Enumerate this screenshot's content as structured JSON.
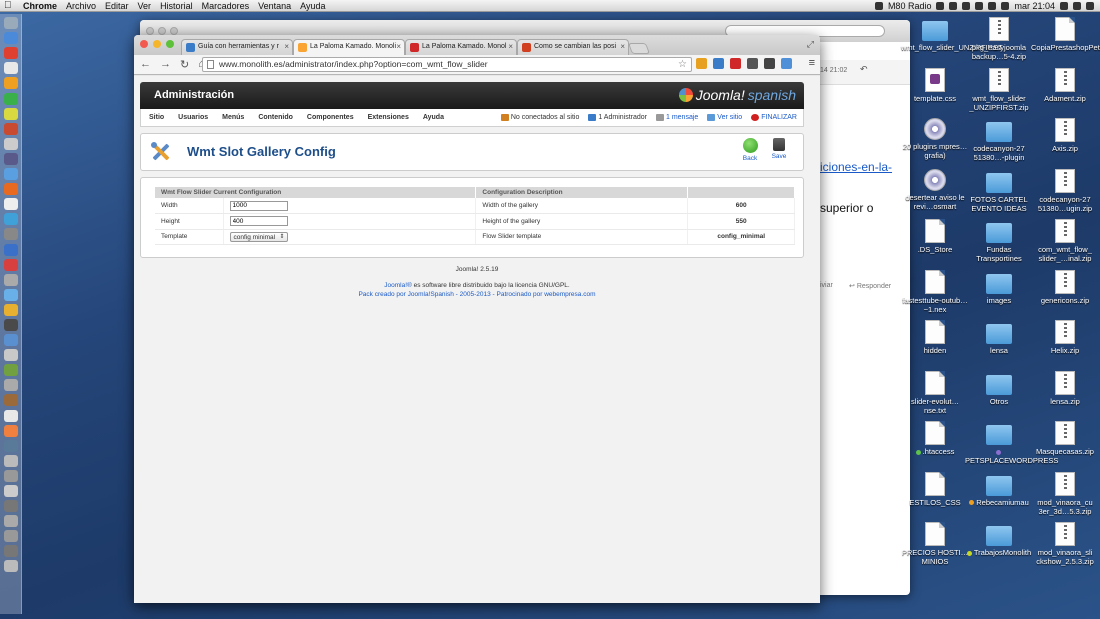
{
  "menubar": {
    "app": "Chrome",
    "menus": [
      "Archivo",
      "Editar",
      "Ver",
      "Historial",
      "Marcadores",
      "Ventana",
      "Ayuda"
    ],
    "radio": "M80 Radio",
    "clock": "mar 21:04"
  },
  "back_window": {
    "link_text": "iciones-en-la-",
    "text1": "superior o",
    "time": "14 21:02",
    "action_left": "iviar",
    "action_reply": "Responder"
  },
  "desktop_icons": [
    {
      "label": "wmt_flow_slider_UNZIPFIRST",
      "kind": "folder"
    },
    {
      "label": "pkg_easyjoomla backup…5-4.zip",
      "kind": "zip"
    },
    {
      "label": "CopiaPrestashopPetsPlace.sql.gz",
      "kind": "file"
    },
    {
      "label": "template.css",
      "kind": "css"
    },
    {
      "label": "wmt_flow_slider _UNZIPFIRST.zip",
      "kind": "zip"
    },
    {
      "label": "Adament.zip",
      "kind": "zip"
    },
    {
      "label": "20 plugins mpres…grafia)",
      "kind": "cd"
    },
    {
      "label": "codecanyon-27 51380…-plugin",
      "kind": "folder"
    },
    {
      "label": "Axis.zip",
      "kind": "zip"
    },
    {
      "label": "desertear aviso le revi…osmart",
      "kind": "cd"
    },
    {
      "label": "FOTOS CARTEL EVENTO IDEAS",
      "kind": "folder"
    },
    {
      "label": "codecanyon-27 51380…ugin.zip",
      "kind": "zip"
    },
    {
      "label": ".DS_Store",
      "kind": "file"
    },
    {
      "label": "Fundas Transportines",
      "kind": "folder"
    },
    {
      "label": "com_wmt_flow_ slider_…inal.zip",
      "kind": "zip"
    },
    {
      "label": "fastesttube-outub…~1.nex",
      "kind": "file"
    },
    {
      "label": "images",
      "kind": "folder"
    },
    {
      "label": "genericons.zip",
      "kind": "zip"
    },
    {
      "label": "hidden",
      "kind": "file"
    },
    {
      "label": "lensa",
      "kind": "folder"
    },
    {
      "label": "Helix.zip",
      "kind": "zip"
    },
    {
      "label": "slider-evolut…nse.txt",
      "kind": "file"
    },
    {
      "label": "Otros",
      "kind": "folder"
    },
    {
      "label": "lensa.zip",
      "kind": "zip"
    },
    {
      "label": ".htaccess",
      "kind": "file",
      "tag": "#5fc34a"
    },
    {
      "label": "PETSPLACEWORDPRESS",
      "kind": "folder",
      "tag": "#8a6fd0"
    },
    {
      "label": "Masquecasas.zip",
      "kind": "zip"
    },
    {
      "label": "ESTILOS_CSS",
      "kind": "file"
    },
    {
      "label": "Rebecamiumau",
      "kind": "folder",
      "tag": "#f0a020"
    },
    {
      "label": "mod_vinaora_cu 3er_3d…5.3.zip",
      "kind": "zip"
    },
    {
      "label": "PRECIOS HOSTI…MINIOS",
      "kind": "file"
    },
    {
      "label": "TrabajosMonolith",
      "kind": "folder",
      "tag": "#c8d820"
    },
    {
      "label": "mod_vinaora_sli ckshow_2.5.3.zip",
      "kind": "zip"
    }
  ],
  "browser": {
    "tabs": [
      {
        "label": "Guía con herramientas y r",
        "fav": "#3a7cc8",
        "active": false
      },
      {
        "label": "La Paloma Kamado. Monoli",
        "fav": "#f9a433",
        "active": true
      },
      {
        "label": "La Paloma Kamado. Monol",
        "fav": "#d02828",
        "active": false
      },
      {
        "label": "Como se cambian las posi",
        "fav": "#d04020",
        "active": false
      }
    ],
    "url": "www.monolith.es/administrator/index.php?option=com_wmt_flow_slider",
    "ext_colors": [
      "#e8a020",
      "#3a7cc8",
      "#d02828",
      "#555",
      "#444",
      "#5090d8"
    ]
  },
  "admin": {
    "title": "Administración",
    "logo_text": "Joomla!",
    "logo_sub": "spanish",
    "menu": [
      "Sitio",
      "Usuarios",
      "Menús",
      "Contenido",
      "Componentes",
      "Extensiones",
      "Ayuda"
    ],
    "status": {
      "visitors": "No conectados al sitio",
      "admins": "1 Administrador",
      "messages": "1 mensaje",
      "view_site": "Ver sitio",
      "logout": "FINALIZAR"
    },
    "page_title": "Wmt Slot Gallery Config",
    "back_label": "Back",
    "save_label": "Save"
  },
  "config_table": {
    "headers": [
      "Wmt Flow Slider Current Configuration",
      "",
      "Configuration Description",
      ""
    ],
    "rows": [
      {
        "name": "Width",
        "value": "1000",
        "description": "Width of the gallery",
        "current": "600"
      },
      {
        "name": "Height",
        "value": "400",
        "description": "Height of the gallery",
        "current": "550"
      },
      {
        "name": "Template",
        "value": "config minimal",
        "description": "Flow Slider template",
        "current": "config_minimal"
      }
    ]
  },
  "footer": {
    "version": "Joomla! 2.5.19",
    "license_link": "Joomla!®",
    "license_text": " es software libre distribuido bajo la licencia GNU/GPL.",
    "pack_text": "Pack creado por Joomla!Spanish - 2005-2013 - Patrocinado por ",
    "sponsor": "webempresa.com"
  }
}
